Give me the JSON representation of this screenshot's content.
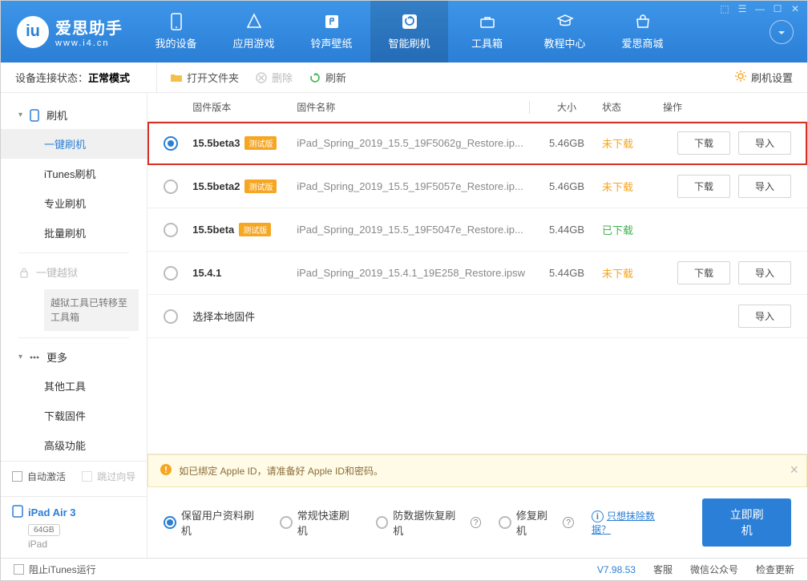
{
  "app": {
    "title": "爱思助手",
    "url": "www.i4.cn"
  },
  "nav": {
    "items": [
      {
        "label": "我的设备"
      },
      {
        "label": "应用游戏"
      },
      {
        "label": "铃声壁纸"
      },
      {
        "label": "智能刷机"
      },
      {
        "label": "工具箱"
      },
      {
        "label": "教程中心"
      },
      {
        "label": "爱思商城"
      }
    ]
  },
  "toolbar": {
    "conn_label": "设备连接状态：",
    "conn_mode": "正常模式",
    "open_folder": "打开文件夹",
    "delete": "删除",
    "refresh": "刷新",
    "settings": "刷机设置"
  },
  "sidebar": {
    "group_flash": "刷机",
    "items_flash": [
      {
        "label": "一键刷机"
      },
      {
        "label": "iTunes刷机"
      },
      {
        "label": "专业刷机"
      },
      {
        "label": "批量刷机"
      }
    ],
    "jailbreak": "一键越狱",
    "jailbreak_notice": "越狱工具已转移至工具箱",
    "group_more": "更多",
    "items_more": [
      {
        "label": "其他工具"
      },
      {
        "label": "下载固件"
      },
      {
        "label": "高级功能"
      }
    ],
    "auto_activate": "自动激活",
    "skip_guide": "跳过向导"
  },
  "device": {
    "name": "iPad Air 3",
    "storage": "64GB",
    "model": "iPad"
  },
  "columns": {
    "version": "固件版本",
    "name": "固件名称",
    "size": "大小",
    "status": "状态",
    "action": "操作"
  },
  "firmware": [
    {
      "version": "15.5beta3",
      "beta": "测试版",
      "name": "iPad_Spring_2019_15.5_19F5062g_Restore.ip...",
      "size": "5.46GB",
      "status": "未下载",
      "status_cls": "st-orange",
      "selected": true,
      "download": "下载",
      "import": "导入"
    },
    {
      "version": "15.5beta2",
      "beta": "测试版",
      "name": "iPad_Spring_2019_15.5_19F5057e_Restore.ip...",
      "size": "5.46GB",
      "status": "未下载",
      "status_cls": "st-orange",
      "selected": false,
      "download": "下载",
      "import": "导入"
    },
    {
      "version": "15.5beta",
      "beta": "测试版",
      "name": "iPad_Spring_2019_15.5_19F5047e_Restore.ip...",
      "size": "5.44GB",
      "status": "已下载",
      "status_cls": "st-green",
      "selected": false
    },
    {
      "version": "15.4.1",
      "name": "iPad_Spring_2019_15.4.1_19E258_Restore.ipsw",
      "size": "5.44GB",
      "status": "未下载",
      "status_cls": "st-orange",
      "selected": false,
      "download": "下载",
      "import": "导入"
    }
  ],
  "local_fw": {
    "label": "选择本地固件",
    "import": "导入"
  },
  "notice": "如已绑定 Apple ID，请准备好 Apple ID和密码。",
  "options": {
    "keep_data": "保留用户资料刷机",
    "normal": "常规快速刷机",
    "anti_recovery": "防数据恢复刷机",
    "repair": "修复刷机",
    "erase_link": "只想抹除数据？",
    "flash_btn": "立即刷机"
  },
  "statusbar": {
    "block_itunes": "阻止iTunes运行",
    "version": "V7.98.53",
    "service": "客服",
    "wechat": "微信公众号",
    "update": "检查更新"
  }
}
